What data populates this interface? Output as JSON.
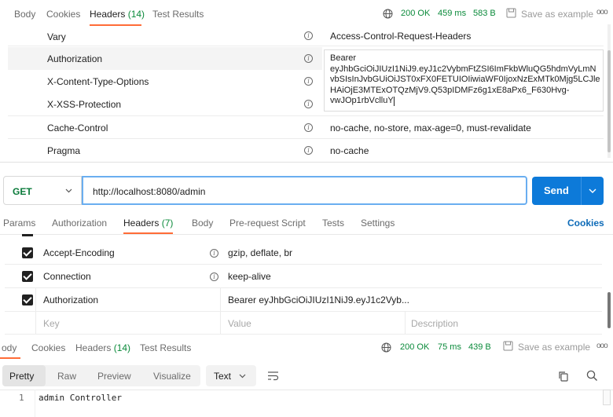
{
  "top_response": {
    "tabs": [
      "Body",
      "Cookies",
      "Headers",
      "Test Results"
    ],
    "headers_count": "(14)",
    "status": "200 OK",
    "time": "459 ms",
    "size": "583 B",
    "save_label": "Save as example",
    "more": "ooo",
    "rows": [
      {
        "key": "Vary",
        "value": "Access-Control-Request-Headers"
      },
      {
        "key": "Authorization",
        "value": ""
      },
      {
        "key": "X-Content-Type-Options",
        "value": ""
      },
      {
        "key": "X-XSS-Protection",
        "value": ""
      },
      {
        "key": "Cache-Control",
        "value": "no-cache, no-store, max-age=0, must-revalidate"
      },
      {
        "key": "Pragma",
        "value": "no-cache"
      }
    ],
    "token_lines": [
      "Bearer",
      "eyJhbGciOiJIUzI1NiJ9.eyJ1c2VybmFtZSI6ImFkbWluQG5hdmVyLmN",
      "vbSIsInJvbGUiOiJST0xFX0FETUIOIiwiaWF0IjoxNzExMTk0Mjg5LCJle",
      "HAiOjE3MTExOTQzMjV9.Q53pIDMFz6g1xE8aPx6_F630Hvg-",
      "vwJOp1rbVclluY"
    ]
  },
  "request": {
    "method": "GET",
    "url": "http://localhost:8080/admin",
    "send": "Send",
    "tabs": [
      "Params",
      "Authorization",
      "Headers",
      "Body",
      "Pre-request Script",
      "Tests",
      "Settings"
    ],
    "headers_count": "(7)",
    "cookies": "Cookies",
    "rows": [
      {
        "key": "Accept-Encoding",
        "value": "gzip, deflate, br"
      },
      {
        "key": "Connection",
        "value": "keep-alive"
      },
      {
        "key": "Authorization",
        "value": "Bearer eyJhbGciOiJIUzI1NiJ9.eyJ1c2Vyb..."
      }
    ],
    "placeholders": {
      "key": "Key",
      "value": "Value",
      "description": "Description"
    }
  },
  "bottom_response": {
    "tabs": [
      "ody",
      "Cookies",
      "Headers",
      "Test Results"
    ],
    "headers_count": "(14)",
    "status": "200 OK",
    "time": "75 ms",
    "size": "439 B",
    "save_label": "Save as example",
    "more": "ooo",
    "view_tabs": [
      "Pretty",
      "Raw",
      "Preview",
      "Visualize"
    ],
    "format": "Text",
    "line_number": "1",
    "body_text": "admin Controller"
  },
  "colors": {
    "accent": "#ff6c37",
    "send": "#0d7ad9",
    "status_green": "#0a8a3a",
    "cookies_blue": "#0d6bb8"
  }
}
